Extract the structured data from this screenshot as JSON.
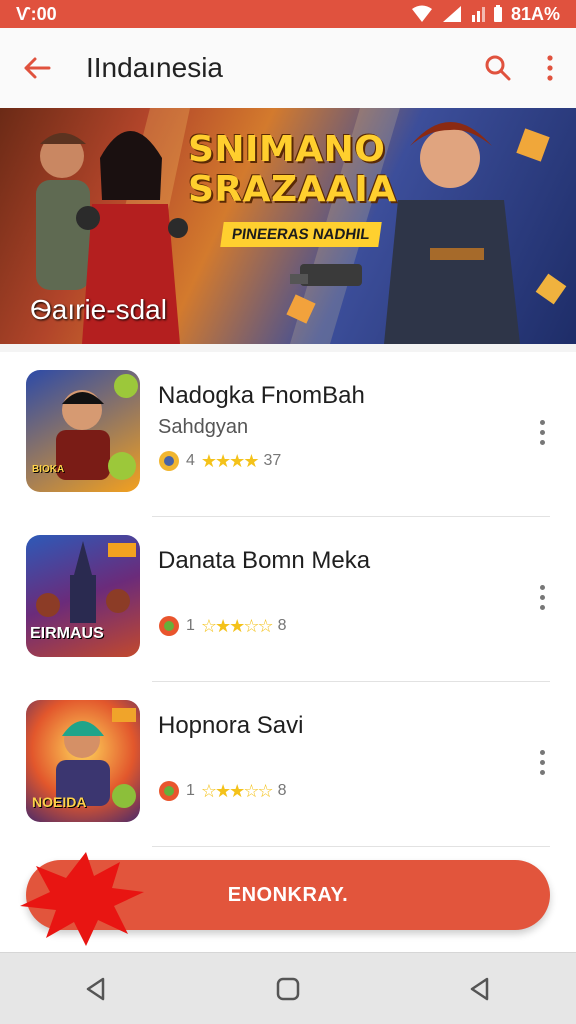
{
  "status_bar": {
    "time": "Ѵ:00",
    "battery": "81A%"
  },
  "app_bar": {
    "title": "IIndaınesia"
  },
  "banner": {
    "headline_line1": "SNIMANO",
    "headline_line2": "SRAZAAIA",
    "tagline": "PINEERAS NADHIL",
    "caption": "Ѳaırie-sdal"
  },
  "apps": [
    {
      "name": "Nadogka FnomBah",
      "developer": "Sahdgyan",
      "rating_text": "4",
      "count_text": "37",
      "thumb_label": "BIOKA",
      "colors": {
        "bg": "#3a56a8",
        "accent": "#f4a51c"
      }
    },
    {
      "name": "Danata Bomn Meka",
      "developer": "",
      "rating_text": "1",
      "count_text": "8",
      "thumb_label": "EIRMAUS",
      "colors": {
        "bg": "#4c3c8a",
        "accent": "#f09630"
      }
    },
    {
      "name": "Hopnora Savi",
      "developer": "",
      "rating_text": "1",
      "count_text": "8",
      "thumb_label": "NOEIDA",
      "colors": {
        "bg": "#c74420",
        "accent": "#ffc534"
      }
    }
  ],
  "cta": {
    "label": "ENONKRAY."
  },
  "theme": {
    "accent": "#e0523e",
    "star": "#f4c21a"
  }
}
